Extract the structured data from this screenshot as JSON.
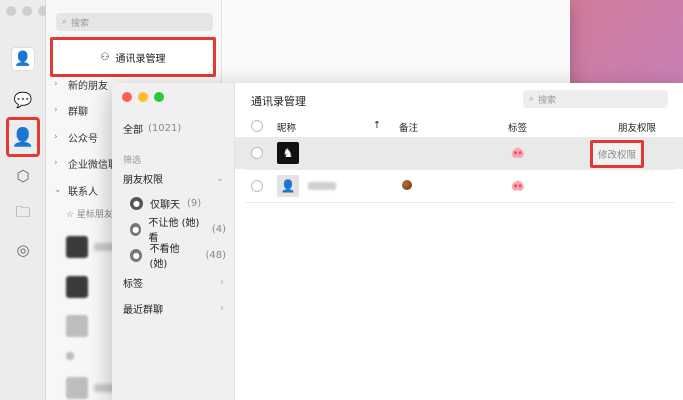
{
  "back_window": {
    "search_placeholder": "搜索",
    "manage_button": "通讯录管理",
    "groups": [
      {
        "label": "新的朋友"
      },
      {
        "label": "群聊"
      },
      {
        "label": "公众号"
      },
      {
        "label": "企业微信联系人"
      },
      {
        "label": "联系人"
      }
    ],
    "starred": "☆ 星标朋友",
    "icons": [
      "avatar-icon",
      "chat-icon",
      "contacts-icon",
      "cube-icon",
      "folder-icon",
      "aperture-icon"
    ]
  },
  "front_window": {
    "sidebar": {
      "all_label": "全部",
      "all_count": "(1021)",
      "filter_label": "筛选",
      "perm_label": "朋友权限",
      "perm_items": [
        {
          "label": "仅聊天",
          "count": "(9)"
        },
        {
          "label": "不让他 (她) 看",
          "count": "(4)"
        },
        {
          "label": "不看他 (她)",
          "count": "(48)"
        }
      ],
      "tags_label": "标签",
      "groups_label": "最近群聊"
    },
    "title": "通讯录管理",
    "search_placeholder": "搜索",
    "columns": {
      "nickname": "昵称",
      "sort_arrow": "↑",
      "remark": "备注",
      "tag": "标签",
      "permission": "朋友权限"
    },
    "rows": [
      {
        "selected": true,
        "tag": "🐽",
        "action": "修改权限"
      },
      {
        "selected": false,
        "remark": "",
        "tag": "🐽"
      }
    ]
  },
  "colors": {
    "highlight": "#e23a32",
    "accent_green": "#07c160"
  }
}
